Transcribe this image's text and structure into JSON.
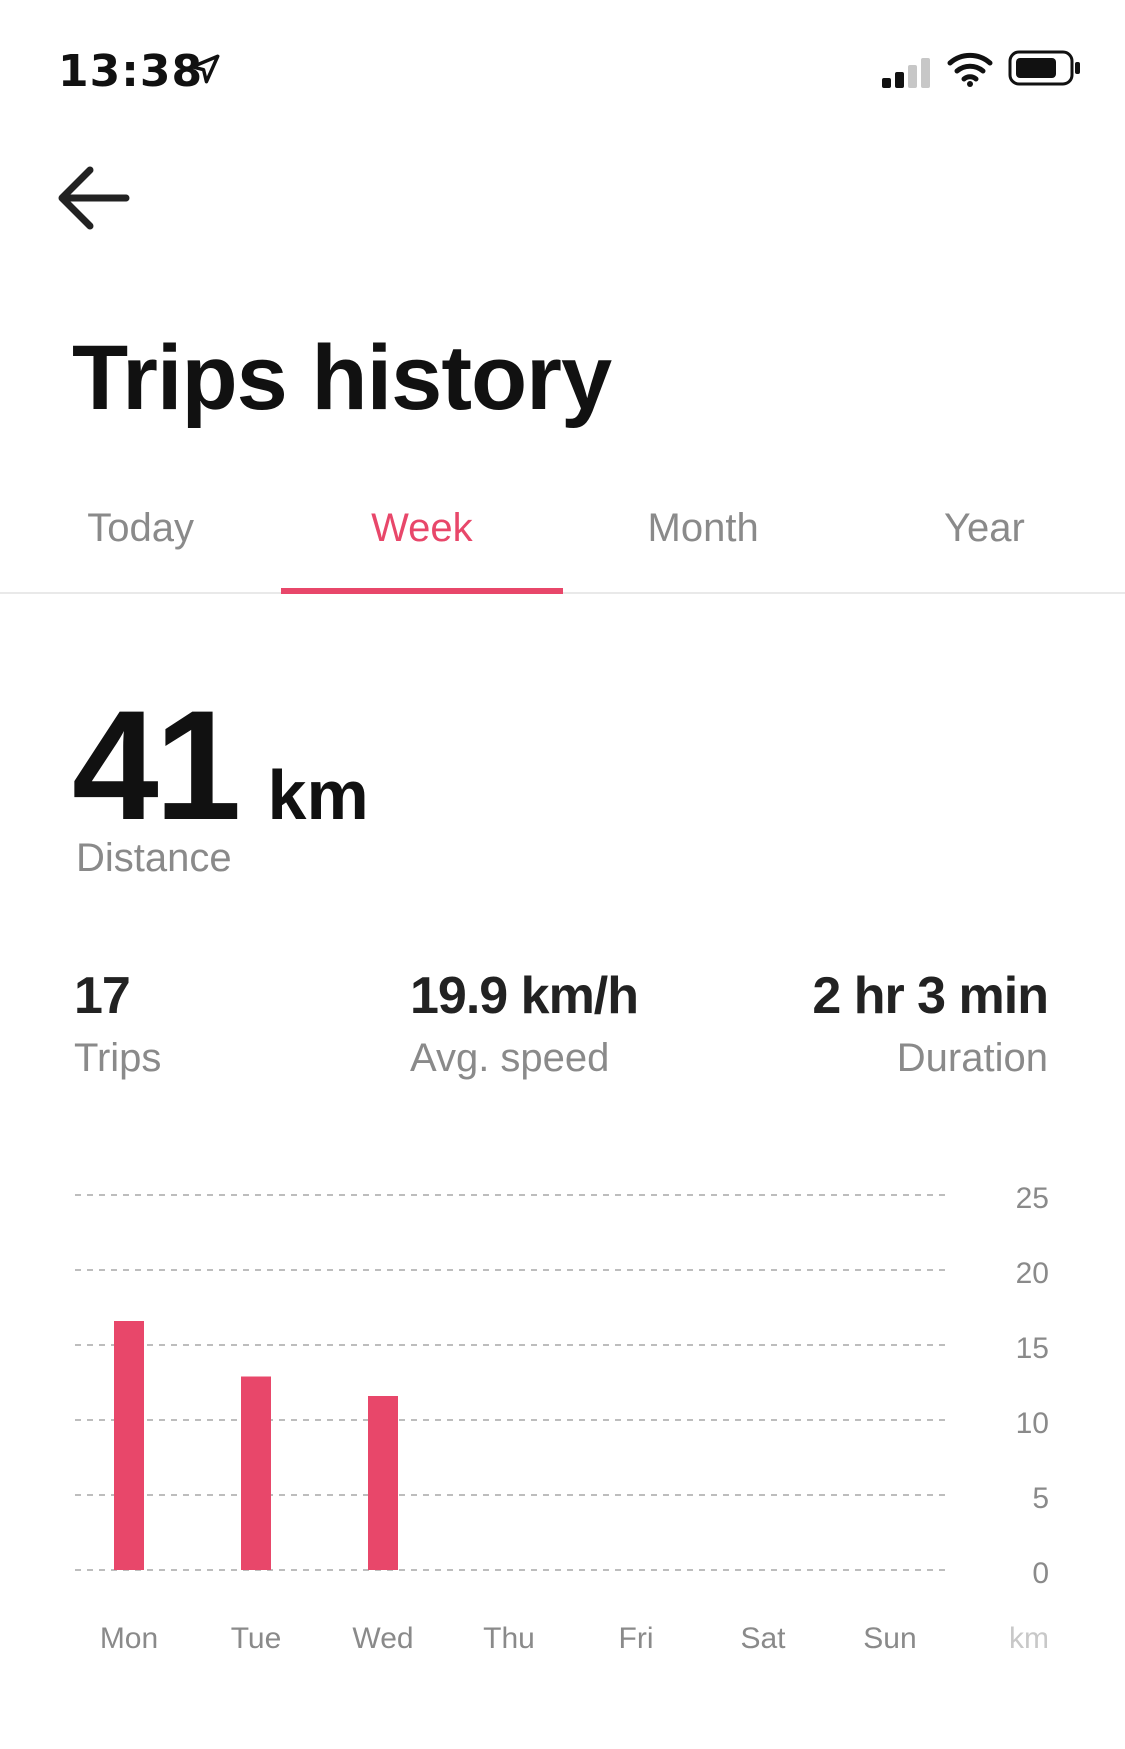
{
  "status_bar": {
    "time": "13:38",
    "location_icon": "location-arrow-icon",
    "signal_icon": "cellular-signal-icon",
    "wifi_icon": "wifi-icon",
    "battery_icon": "battery-icon"
  },
  "header": {
    "back_icon": "back-arrow-icon",
    "title": "Trips history"
  },
  "tabs": [
    {
      "label": "Today",
      "active": false
    },
    {
      "label": "Week",
      "active": true
    },
    {
      "label": "Month",
      "active": false
    },
    {
      "label": "Year",
      "active": false
    }
  ],
  "summary": {
    "distance_value": "41",
    "distance_unit": "km",
    "distance_label": "Distance",
    "trips_value": "17",
    "trips_label": "Trips",
    "speed_value": "19.9 km/h",
    "speed_label": "Avg. speed",
    "duration_value": "2 hr 3 min",
    "duration_label": "Duration"
  },
  "colors": {
    "accent": "#e8476a",
    "muted_text": "#8a8a8a",
    "grid": "#bdbdbd"
  },
  "chart_data": {
    "type": "bar",
    "categories": [
      "Mon",
      "Tue",
      "Wed",
      "Thu",
      "Fri",
      "Sat",
      "Sun"
    ],
    "values": [
      16.6,
      12.9,
      11.6,
      0,
      0,
      0,
      0
    ],
    "y_ticks": [
      0,
      5,
      10,
      15,
      20,
      25
    ],
    "ylim": [
      0,
      25
    ],
    "ylabel": "km",
    "grid": true,
    "bar_color": "#e8476a"
  }
}
